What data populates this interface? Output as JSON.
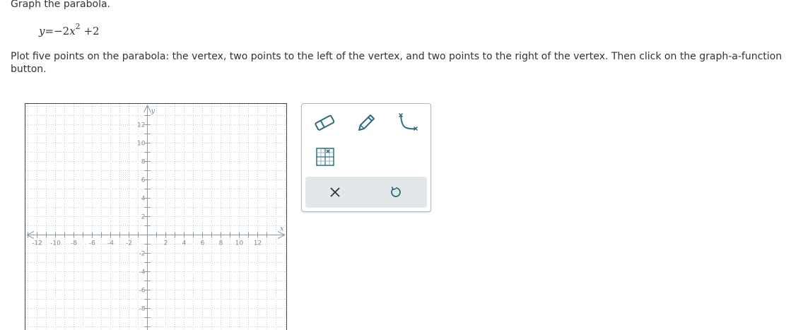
{
  "instruction": "Graph the parabola.",
  "equation": {
    "lhs_var": "y",
    "equals": "=",
    "coef": "−2",
    "rhs_var": "x",
    "exponent": "2",
    "constant": "+2"
  },
  "directions": "Plot five points on the parabola: the vertex, two points to the left of the vertex, and two points to the right of the vertex. Then click on the graph-a-function button.",
  "graph": {
    "x_axis_label": "x",
    "y_axis_label": "y",
    "x_tick_labels": [
      {
        "value": -12,
        "text": "-12"
      },
      {
        "value": -10,
        "text": "-10"
      },
      {
        "value": -8,
        "text": "-8"
      },
      {
        "value": -6,
        "text": "-6"
      },
      {
        "value": -4,
        "text": "-4"
      },
      {
        "value": -2,
        "text": "-2"
      },
      {
        "value": 2,
        "text": "2"
      },
      {
        "value": 4,
        "text": "4"
      },
      {
        "value": 6,
        "text": "6"
      },
      {
        "value": 8,
        "text": "8"
      },
      {
        "value": 10,
        "text": "10"
      },
      {
        "value": 12,
        "text": "12"
      }
    ],
    "y_tick_labels": [
      {
        "value": 12,
        "text": "12"
      },
      {
        "value": 10,
        "text": "10"
      },
      {
        "value": 8,
        "text": "8"
      },
      {
        "value": 6,
        "text": "6"
      },
      {
        "value": 4,
        "text": "4"
      },
      {
        "value": 2,
        "text": "2"
      },
      {
        "value": -2,
        "text": "-2"
      },
      {
        "value": -4,
        "text": "-4"
      },
      {
        "value": -6,
        "text": "-6"
      },
      {
        "value": -8,
        "text": "-8"
      }
    ],
    "x_range": [
      -14,
      14
    ],
    "y_range": [
      -9,
      13
    ],
    "grid": true
  },
  "toolbox": {
    "tools": [
      "eraser-icon",
      "pencil-icon",
      "parabola-icon",
      "grid-points-icon"
    ],
    "clear_symbol": "✕",
    "undo_symbol": "↺"
  },
  "colors": {
    "tool_icon": "#2c6c80",
    "axis": "#8899a6",
    "grid": "#c5ced6",
    "action_bar": "#e2e7ea"
  }
}
